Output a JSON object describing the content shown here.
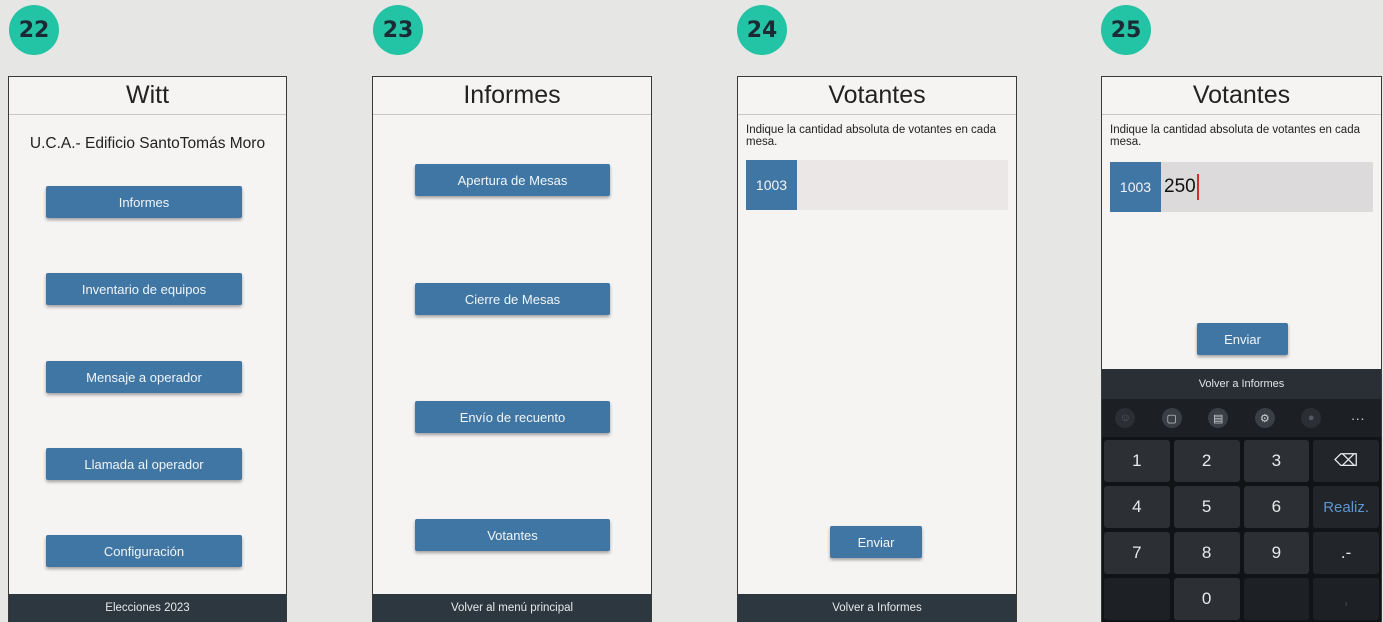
{
  "screens": [
    {
      "badge": "22",
      "title": "Witt",
      "subtitle": "U.C.A.- Edificio SantoTomás Moro",
      "buttons": [
        "Informes",
        "Inventario de equipos",
        "Mensaje a operador",
        "Llamada al operador",
        "Configuración"
      ],
      "footer": "Elecciones 2023"
    },
    {
      "badge": "23",
      "title": "Informes",
      "buttons": [
        "Apertura de Mesas",
        "Cierre de Mesas",
        "Envío de recuento",
        "Votantes"
      ],
      "footer": "Volver al menú principal"
    },
    {
      "badge": "24",
      "title": "Votantes",
      "prompt": "Indique la cantidad absoluta de votantes en cada mesa.",
      "mesa": "1003",
      "value": "",
      "send": "Enviar",
      "footer": "Volver a Informes"
    },
    {
      "badge": "25",
      "title": "Votantes",
      "prompt": "Indique la cantidad absoluta de votantes en cada mesa.",
      "mesa": "1003",
      "value": "250",
      "send": "Enviar",
      "footer": "Volver a Informes",
      "keyboard": {
        "toolbar_icons": [
          "emoji-icon",
          "clipboard-icon",
          "notes-icon",
          "settings-icon",
          "mic-icon",
          "more-icon"
        ],
        "keys": [
          "1",
          "2",
          "3",
          "⌫",
          "4",
          "5",
          "6",
          "Realiz.",
          "7",
          "8",
          "9",
          ".-",
          "",
          "0",
          "",
          ","
        ]
      }
    }
  ],
  "colors": {
    "badge": "#23c4a5",
    "button": "#3f76a3",
    "footer": "#2d3740",
    "caret": "#d32c2c"
  }
}
